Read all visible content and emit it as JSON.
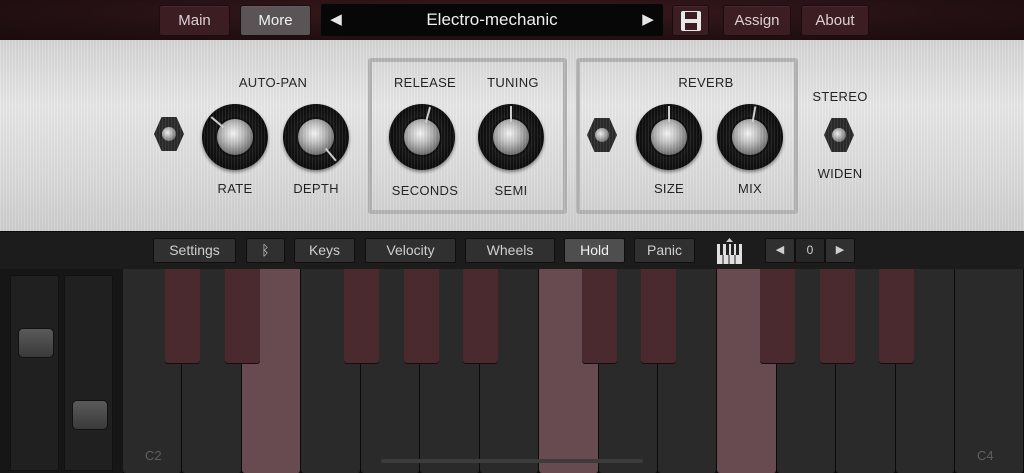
{
  "topbar": {
    "main_label": "Main",
    "more_label": "More",
    "preset_name": "Electro-mechanic",
    "prev_arrow": "◀",
    "next_arrow": "▶",
    "save_icon": "floppy-disk-icon",
    "assign_label": "Assign",
    "about_label": "About"
  },
  "panel": {
    "autopan": {
      "title": "AUTO-PAN",
      "rate_label": "RATE",
      "depth_label": "DEPTH"
    },
    "release": {
      "title": "RELEASE",
      "unit_label": "SECONDS"
    },
    "tuning": {
      "title": "TUNING",
      "unit_label": "SEMI"
    },
    "reverb": {
      "title": "REVERB",
      "size_label": "SIZE",
      "mix_label": "MIX"
    },
    "stereo": {
      "title": "STEREO",
      "sub_label": "WIDEN"
    }
  },
  "toolbar": {
    "settings_label": "Settings",
    "bluetooth_icon": "bluetooth-icon",
    "keys_label": "Keys",
    "velocity_label": "Velocity",
    "wheels_label": "Wheels",
    "hold_label": "Hold",
    "panic_label": "Panic",
    "keyboard_icon": "piano-keys-icon",
    "octave_value": "0",
    "octave_down": "◀",
    "octave_up": "▶"
  },
  "keyboard": {
    "label_c2": "C2",
    "label_c4": "C4"
  },
  "colors": {
    "topbar_bg": "#241013",
    "accent_key": "#674b50",
    "black_key": "#4a2a2f"
  }
}
